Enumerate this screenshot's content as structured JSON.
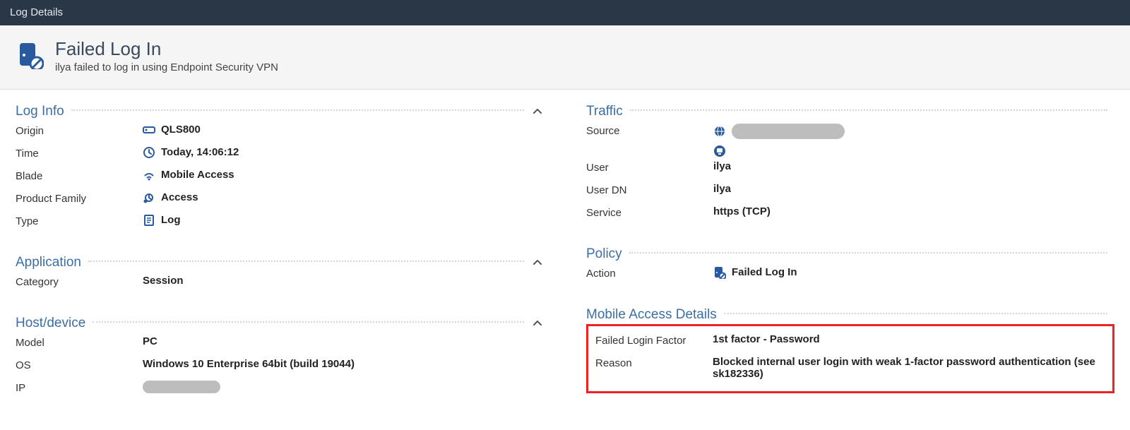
{
  "titlebar": "Log Details",
  "header": {
    "title": "Failed Log In",
    "subtitle": "ilya failed to log in using Endpoint Security VPN"
  },
  "left": {
    "log_info": {
      "title": "Log Info",
      "origin_label": "Origin",
      "origin_value": "QLS800",
      "time_label": "Time",
      "time_value": "Today, 14:06:12",
      "blade_label": "Blade",
      "blade_value": "Mobile Access",
      "pf_label": "Product Family",
      "pf_value": "Access",
      "type_label": "Type",
      "type_value": "Log"
    },
    "application": {
      "title": "Application",
      "category_label": "Category",
      "category_value": "Session"
    },
    "host": {
      "title": "Host/device",
      "model_label": "Model",
      "model_value": "PC",
      "os_label": "OS",
      "os_value": "Windows 10 Enterprise 64bit (build 19044)",
      "ip_label": "IP"
    }
  },
  "right": {
    "traffic": {
      "title": "Traffic",
      "source_label": "Source",
      "user_label": "User",
      "user_value": "ilya",
      "userdn_label": "User DN",
      "userdn_value": "ilya",
      "service_label": "Service",
      "service_value": "https (TCP)"
    },
    "policy": {
      "title": "Policy",
      "action_label": "Action",
      "action_value": "Failed Log In"
    },
    "mad": {
      "title": "Mobile Access Details",
      "flf_label": "Failed Login Factor",
      "flf_value": "1st factor - Password",
      "reason_label": "Reason",
      "reason_value": "Blocked internal user login with weak 1-factor password authentication (see sk182336)"
    }
  }
}
